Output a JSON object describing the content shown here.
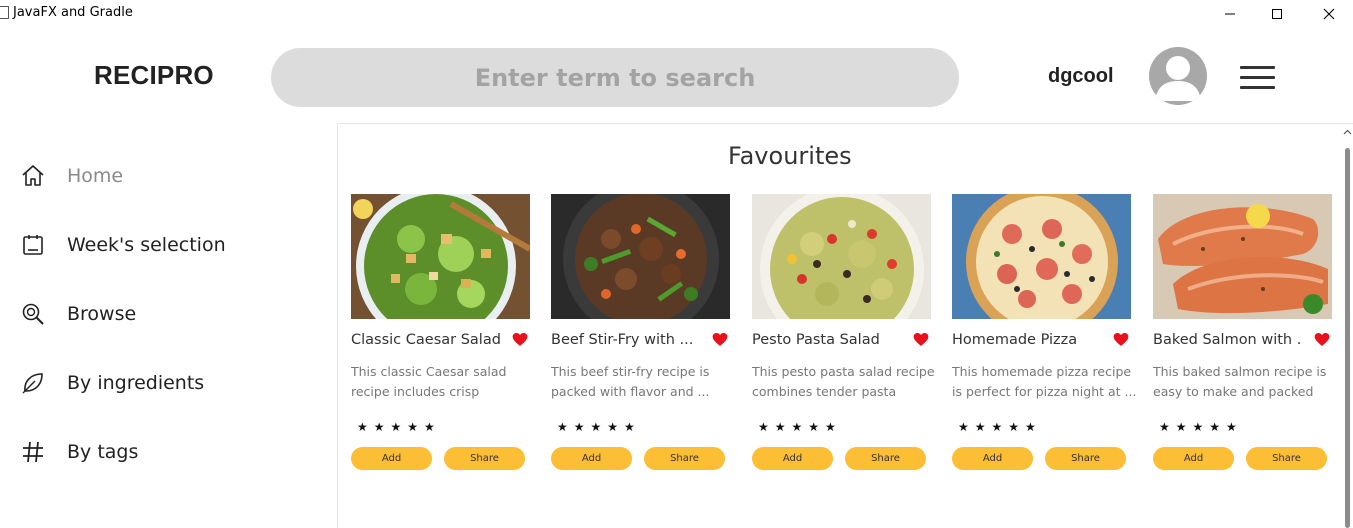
{
  "window": {
    "title": "JavaFX and Gradle"
  },
  "header": {
    "logo": "RECIPRO",
    "search_placeholder": "Enter term to search",
    "username": "dgcool"
  },
  "sidebar": {
    "items": [
      {
        "label": "Home",
        "icon": "home-icon",
        "active": true
      },
      {
        "label": "Week's selection",
        "icon": "calendar-icon",
        "active": false
      },
      {
        "label": "Browse",
        "icon": "browse-icon",
        "active": false
      },
      {
        "label": "By ingredients",
        "icon": "leaf-icon",
        "active": false
      },
      {
        "label": "By tags",
        "icon": "hashtag-icon",
        "active": false
      }
    ]
  },
  "main": {
    "section_title": "Favourites",
    "cards": [
      {
        "title": "Classic Caesar Salad",
        "description": "This classic Caesar salad recipe includes crisp",
        "stars": "★★★★★",
        "add_label": "Add",
        "share_label": "Share",
        "image": "caesar-salad-photo"
      },
      {
        "title": "Beef Stir-Fry with ...",
        "description": "This beef stir-fry recipe is packed with flavor and ...",
        "stars": "★★★★★",
        "add_label": "Add",
        "share_label": "Share",
        "image": "beef-stir-fry-photo"
      },
      {
        "title": "Pesto Pasta Salad",
        "description": "This pesto pasta salad recipe combines tender pasta shells...",
        "stars": "★★★★★",
        "add_label": "Add",
        "share_label": "Share",
        "image": "pesto-pasta-photo"
      },
      {
        "title": "Homemade Pizza",
        "description": "This homemade pizza recipe is perfect for pizza night at ...",
        "stars": "★★★★★",
        "add_label": "Add",
        "share_label": "Share",
        "image": "pizza-photo"
      },
      {
        "title": "Baked Salmon with ...",
        "description": "This baked salmon recipe is easy to make and packed wit...",
        "stars": "★★★★★",
        "add_label": "Add",
        "share_label": "Share",
        "image": "salmon-photo"
      }
    ]
  },
  "colors": {
    "accent_button": "#fbbe35",
    "heart": "#e8101a",
    "search_bg": "#dcdcdc"
  }
}
